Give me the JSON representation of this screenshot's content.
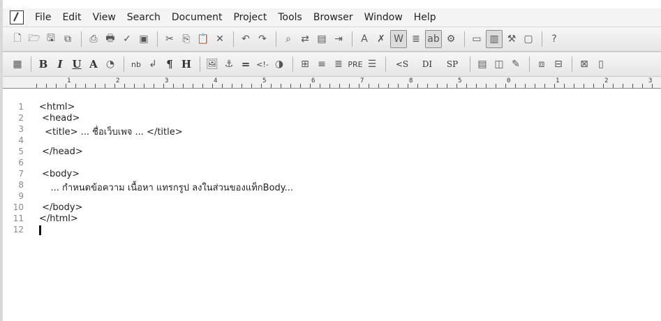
{
  "menubar": {
    "items": [
      "File",
      "Edit",
      "View",
      "Search",
      "Document",
      "Project",
      "Tools",
      "Browser",
      "Window",
      "Help"
    ]
  },
  "toolbar2": {
    "bold_label": "B",
    "italic_label": "I",
    "underline_label": "U",
    "font_label": "A",
    "nbsp_label": "nb",
    "br_label": "↲",
    "para_label": "¶",
    "heading_label": "H",
    "hr_label": "=",
    "comment_label": "<!-",
    "pre_label": "PRE",
    "strike_label": "<S",
    "div_label": "DI",
    "span_label": "SP"
  },
  "ruler": {
    "numbers": [
      "1",
      "2",
      "3",
      "4",
      "5",
      "6",
      "7",
      "8",
      "5",
      "0",
      "1",
      "2",
      "3"
    ]
  },
  "editor": {
    "line_numbers": [
      "1",
      "2",
      "3",
      "4",
      "5",
      "6",
      "7",
      "8",
      "9",
      "10",
      "11",
      "12"
    ],
    "lines": [
      "<html>",
      " <head>",
      "  <title> ... ชื่อเว็บเพจ ... </title>",
      "",
      " </head>",
      "",
      " <body>",
      "    ... กำหนดข้อความ เนื้อหา แทรกรูป ลงในส่วนของแท็กBody...",
      "",
      " </body>",
      "</html>",
      ""
    ]
  }
}
